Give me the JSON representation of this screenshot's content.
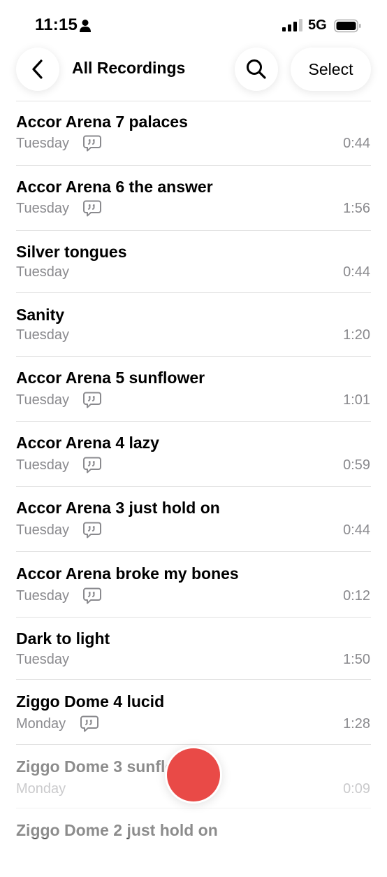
{
  "status_bar": {
    "time": "11:15",
    "network": "5G"
  },
  "nav": {
    "title": "All Recordings",
    "select_label": "Select"
  },
  "colors": {
    "record": "#e94a47",
    "secondary_text": "#8a8a8e"
  },
  "recordings": [
    {
      "title": "Accor Arena 7 palaces",
      "date": "Tuesday",
      "duration": "0:44",
      "transcript": true
    },
    {
      "title": "Accor Arena 6 the answer",
      "date": "Tuesday",
      "duration": "1:56",
      "transcript": true
    },
    {
      "title": "Silver tongues",
      "date": "Tuesday",
      "duration": "0:44",
      "transcript": false
    },
    {
      "title": "Sanity",
      "date": "Tuesday",
      "duration": "1:20",
      "transcript": false
    },
    {
      "title": "Accor Arena 5 sunflower",
      "date": "Tuesday",
      "duration": "1:01",
      "transcript": true
    },
    {
      "title": "Accor Arena 4 lazy",
      "date": "Tuesday",
      "duration": "0:59",
      "transcript": true
    },
    {
      "title": "Accor Arena 3 just hold on",
      "date": "Tuesday",
      "duration": "0:44",
      "transcript": true
    },
    {
      "title": "Accor Arena broke my bones",
      "date": "Tuesday",
      "duration": "0:12",
      "transcript": true
    },
    {
      "title": "Dark to light",
      "date": "Tuesday",
      "duration": "1:50",
      "transcript": false
    },
    {
      "title": "Ziggo Dome 4 lucid",
      "date": "Monday",
      "duration": "1:28",
      "transcript": true
    },
    {
      "title": "Ziggo Dome 3 sunflower",
      "date": "Monday",
      "duration": "0:09",
      "transcript": false
    },
    {
      "title": "Ziggo Dome 2 just hold on",
      "date": "",
      "duration": "",
      "transcript": false
    }
  ]
}
